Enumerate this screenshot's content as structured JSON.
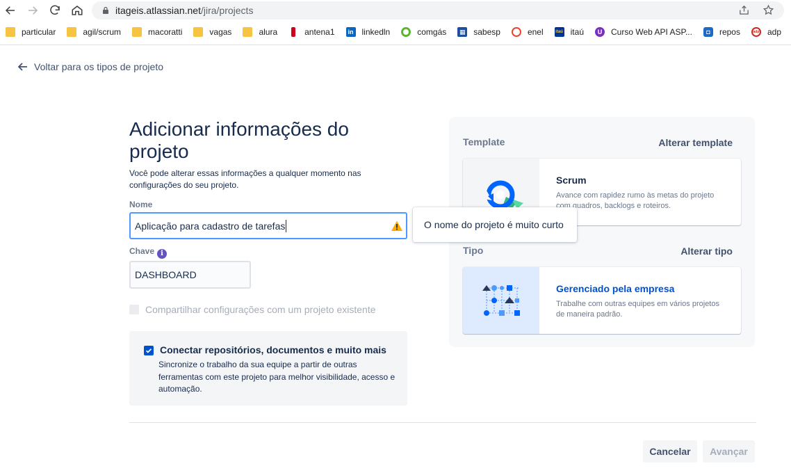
{
  "browser": {
    "url_host": "itageis.atlassian.net",
    "url_path": "/jira/projects",
    "bookmarks": [
      {
        "label": "particular",
        "icon": "folder-icon"
      },
      {
        "label": "agil/scrum",
        "icon": "folder-icon"
      },
      {
        "label": "macoratti",
        "icon": "folder-icon"
      },
      {
        "label": "vagas",
        "icon": "folder-icon"
      },
      {
        "label": "alura",
        "icon": "folder-icon"
      },
      {
        "label": "antena1",
        "icon": "antena1-icon"
      },
      {
        "label": "linkedln",
        "icon": "linkedin-icon"
      },
      {
        "label": "comgás",
        "icon": "comgas-icon"
      },
      {
        "label": "sabesp",
        "icon": "sabesp-icon"
      },
      {
        "label": "enel",
        "icon": "enel-icon"
      },
      {
        "label": "itaú",
        "icon": "itau-icon"
      },
      {
        "label": "Curso Web API ASP...",
        "icon": "course-icon"
      },
      {
        "label": "repos",
        "icon": "repos-icon"
      },
      {
        "label": "adp",
        "icon": "adp-icon"
      }
    ]
  },
  "page": {
    "back_link": "Voltar para os tipos de projeto",
    "title": "Adicionar informações do projeto",
    "subtitle": "Você pode alterar essas informações a qualquer momento nas configurações do seu projeto.",
    "name_label": "Nome",
    "name_value": "Aplicação para cadastro de tarefas",
    "name_tooltip": "O nome do projeto é muito curto",
    "key_label": "Chave",
    "key_value": "DASHBOARD",
    "share_label": "Compartilhar configurações com um projeto existente",
    "connect_title": "Conectar repositórios, documentos e muito mais",
    "connect_desc": "Sincronize o trabalho da sua equipe a partir de outras ferramentas com este projeto para melhor visibilidade, acesso e automação.",
    "cancel_label": "Cancelar",
    "next_label": "Avançar"
  },
  "panel": {
    "template_label": "Template",
    "change_template": "Alterar template",
    "template_title": "Scrum",
    "template_desc": "Avance com rapidez rumo às metas do projeto com quadros, backlogs e roteiros.",
    "type_label": "Tipo",
    "change_type": "Alterar tipo",
    "type_title": "Gerenciado pela empresa",
    "type_desc": "Trabalhe com outras equipes em vários projetos de maneira padrão."
  },
  "colors": {
    "accent": "#0052cc",
    "focus_border": "#4c9aff",
    "warning": "#ffab00",
    "info": "#6554c0"
  }
}
